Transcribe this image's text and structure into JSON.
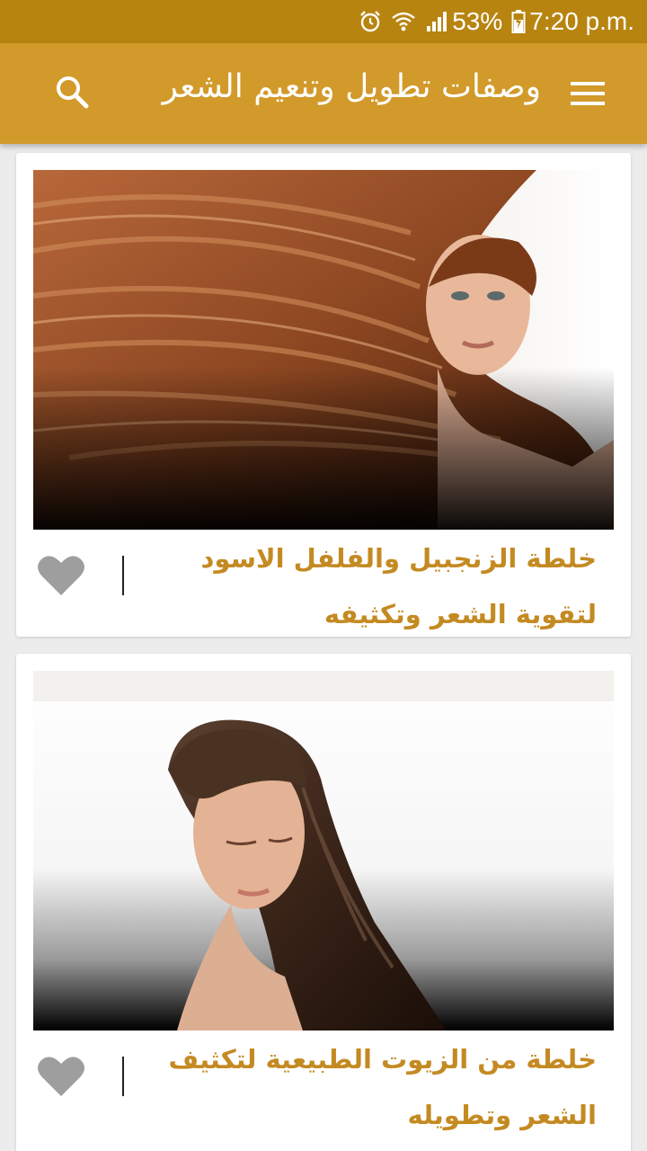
{
  "status_bar": {
    "battery_percent": "53%",
    "time": "7:20 p.m.",
    "icons": [
      "alarm-icon",
      "wifi-icon",
      "signal-icon",
      "battery-charging-icon"
    ]
  },
  "app_bar": {
    "title": "وصفات تطويل وتنعيم الشعر",
    "menu_icon": "hamburger-menu-icon",
    "search_icon": "search-icon"
  },
  "colors": {
    "status_bar": "#b88410",
    "app_bar": "#d29a2a",
    "title_text": "#c48a22",
    "heart": "#9e9e9e"
  },
  "recipes": [
    {
      "title": "خلطة الزنجبيل والفلفل الاسود لتقوية الشعر وتكثيفه",
      "image": "woman-long-auburn-hair-photo",
      "favorite_icon": "heart-icon"
    },
    {
      "title": "خلطة من الزيوت الطبيعية لتكثيف الشعر وتطويله",
      "image": "woman-long-brown-hair-photo",
      "favorite_icon": "heart-icon"
    }
  ]
}
